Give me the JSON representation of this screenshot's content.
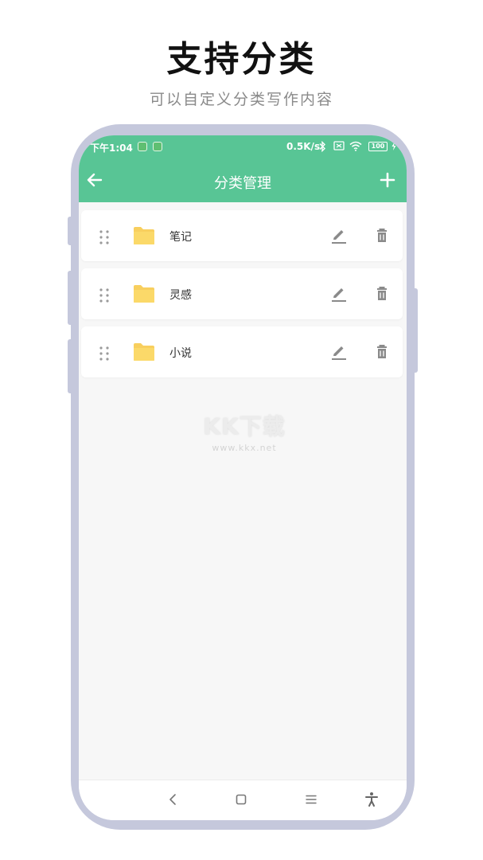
{
  "promo": {
    "title": "支持分类",
    "subtitle": "可以自定义分类写作内容"
  },
  "status_bar": {
    "time": "下午1:04",
    "net_speed": "0.5K/s",
    "battery": "100"
  },
  "header": {
    "title": "分类管理",
    "back_icon": "arrow-left-icon",
    "add_icon": "plus-icon"
  },
  "categories": [
    {
      "label": "笔记"
    },
    {
      "label": "灵感"
    },
    {
      "label": "小说"
    }
  ],
  "watermark": {
    "logo": "KK下载",
    "url": "www.kkx.net"
  },
  "nav_bar": {
    "items": [
      "back-nav-icon",
      "home-nav-icon",
      "menu-nav-icon",
      "accessibility-icon"
    ]
  },
  "colors": {
    "accent": "#58c595",
    "folder": "#f8cf5e",
    "phone_frame": "#c5c8dc",
    "background": "#f7f7f7",
    "icon_gray": "#8a8a8a"
  }
}
